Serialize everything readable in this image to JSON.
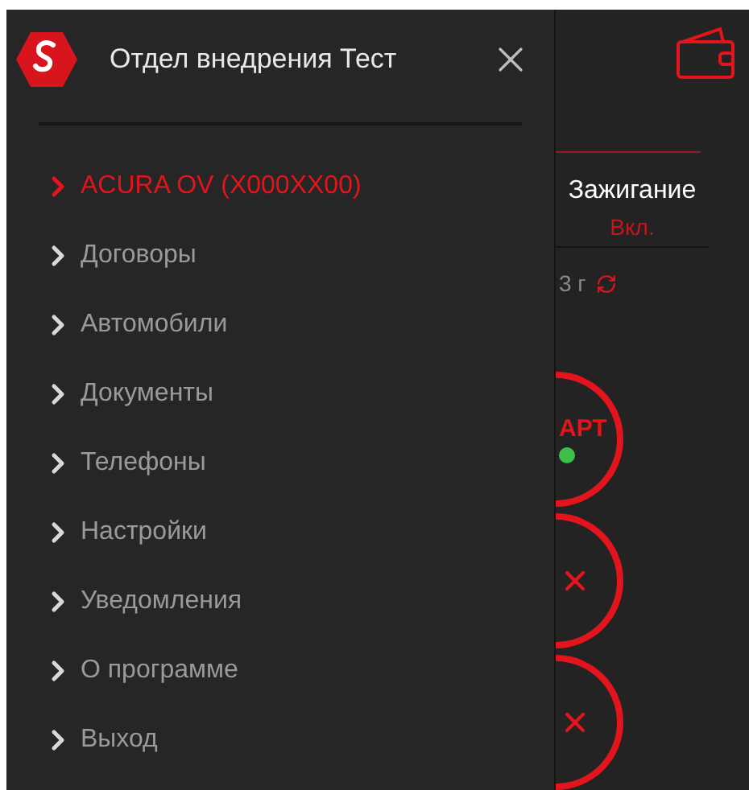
{
  "drawer": {
    "title": "Отдел внедрения Тест",
    "items": [
      {
        "label": "ACURA OV (X000XX00)",
        "selected": true
      },
      {
        "label": "Договоры",
        "selected": false
      },
      {
        "label": "Автомобили",
        "selected": false
      },
      {
        "label": "Документы",
        "selected": false
      },
      {
        "label": "Телефоны",
        "selected": false
      },
      {
        "label": "Настройки",
        "selected": false
      },
      {
        "label": "Уведомления",
        "selected": false
      },
      {
        "label": "О программе",
        "selected": false
      },
      {
        "label": "Выход",
        "selected": false
      }
    ]
  },
  "background": {
    "ignition": {
      "label": "Зажигание",
      "value": "Вкл."
    },
    "age": "3 г",
    "buttons": [
      {
        "kind": "start",
        "label": "АРТ",
        "color": "#3cc04a"
      },
      {
        "kind": "cancel"
      },
      {
        "kind": "cancel"
      }
    ]
  }
}
